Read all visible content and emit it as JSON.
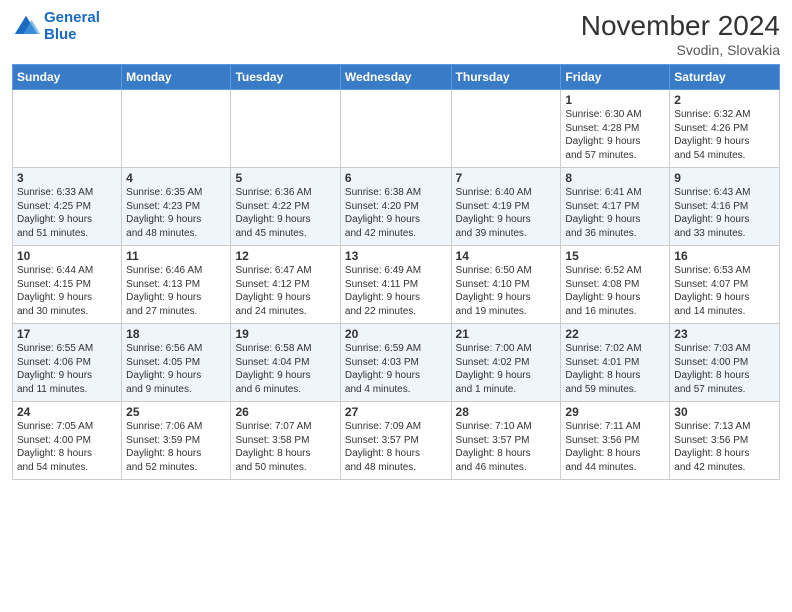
{
  "logo": {
    "line1": "General",
    "line2": "Blue"
  },
  "title": "November 2024",
  "location": "Svodin, Slovakia",
  "days_header": [
    "Sunday",
    "Monday",
    "Tuesday",
    "Wednesday",
    "Thursday",
    "Friday",
    "Saturday"
  ],
  "weeks": [
    [
      {
        "day": "",
        "info": ""
      },
      {
        "day": "",
        "info": ""
      },
      {
        "day": "",
        "info": ""
      },
      {
        "day": "",
        "info": ""
      },
      {
        "day": "",
        "info": ""
      },
      {
        "day": "1",
        "info": "Sunrise: 6:30 AM\nSunset: 4:28 PM\nDaylight: 9 hours\nand 57 minutes."
      },
      {
        "day": "2",
        "info": "Sunrise: 6:32 AM\nSunset: 4:26 PM\nDaylight: 9 hours\nand 54 minutes."
      }
    ],
    [
      {
        "day": "3",
        "info": "Sunrise: 6:33 AM\nSunset: 4:25 PM\nDaylight: 9 hours\nand 51 minutes."
      },
      {
        "day": "4",
        "info": "Sunrise: 6:35 AM\nSunset: 4:23 PM\nDaylight: 9 hours\nand 48 minutes."
      },
      {
        "day": "5",
        "info": "Sunrise: 6:36 AM\nSunset: 4:22 PM\nDaylight: 9 hours\nand 45 minutes."
      },
      {
        "day": "6",
        "info": "Sunrise: 6:38 AM\nSunset: 4:20 PM\nDaylight: 9 hours\nand 42 minutes."
      },
      {
        "day": "7",
        "info": "Sunrise: 6:40 AM\nSunset: 4:19 PM\nDaylight: 9 hours\nand 39 minutes."
      },
      {
        "day": "8",
        "info": "Sunrise: 6:41 AM\nSunset: 4:17 PM\nDaylight: 9 hours\nand 36 minutes."
      },
      {
        "day": "9",
        "info": "Sunrise: 6:43 AM\nSunset: 4:16 PM\nDaylight: 9 hours\nand 33 minutes."
      }
    ],
    [
      {
        "day": "10",
        "info": "Sunrise: 6:44 AM\nSunset: 4:15 PM\nDaylight: 9 hours\nand 30 minutes."
      },
      {
        "day": "11",
        "info": "Sunrise: 6:46 AM\nSunset: 4:13 PM\nDaylight: 9 hours\nand 27 minutes."
      },
      {
        "day": "12",
        "info": "Sunrise: 6:47 AM\nSunset: 4:12 PM\nDaylight: 9 hours\nand 24 minutes."
      },
      {
        "day": "13",
        "info": "Sunrise: 6:49 AM\nSunset: 4:11 PM\nDaylight: 9 hours\nand 22 minutes."
      },
      {
        "day": "14",
        "info": "Sunrise: 6:50 AM\nSunset: 4:10 PM\nDaylight: 9 hours\nand 19 minutes."
      },
      {
        "day": "15",
        "info": "Sunrise: 6:52 AM\nSunset: 4:08 PM\nDaylight: 9 hours\nand 16 minutes."
      },
      {
        "day": "16",
        "info": "Sunrise: 6:53 AM\nSunset: 4:07 PM\nDaylight: 9 hours\nand 14 minutes."
      }
    ],
    [
      {
        "day": "17",
        "info": "Sunrise: 6:55 AM\nSunset: 4:06 PM\nDaylight: 9 hours\nand 11 minutes."
      },
      {
        "day": "18",
        "info": "Sunrise: 6:56 AM\nSunset: 4:05 PM\nDaylight: 9 hours\nand 9 minutes."
      },
      {
        "day": "19",
        "info": "Sunrise: 6:58 AM\nSunset: 4:04 PM\nDaylight: 9 hours\nand 6 minutes."
      },
      {
        "day": "20",
        "info": "Sunrise: 6:59 AM\nSunset: 4:03 PM\nDaylight: 9 hours\nand 4 minutes."
      },
      {
        "day": "21",
        "info": "Sunrise: 7:00 AM\nSunset: 4:02 PM\nDaylight: 9 hours\nand 1 minute."
      },
      {
        "day": "22",
        "info": "Sunrise: 7:02 AM\nSunset: 4:01 PM\nDaylight: 8 hours\nand 59 minutes."
      },
      {
        "day": "23",
        "info": "Sunrise: 7:03 AM\nSunset: 4:00 PM\nDaylight: 8 hours\nand 57 minutes."
      }
    ],
    [
      {
        "day": "24",
        "info": "Sunrise: 7:05 AM\nSunset: 4:00 PM\nDaylight: 8 hours\nand 54 minutes."
      },
      {
        "day": "25",
        "info": "Sunrise: 7:06 AM\nSunset: 3:59 PM\nDaylight: 8 hours\nand 52 minutes."
      },
      {
        "day": "26",
        "info": "Sunrise: 7:07 AM\nSunset: 3:58 PM\nDaylight: 8 hours\nand 50 minutes."
      },
      {
        "day": "27",
        "info": "Sunrise: 7:09 AM\nSunset: 3:57 PM\nDaylight: 8 hours\nand 48 minutes."
      },
      {
        "day": "28",
        "info": "Sunrise: 7:10 AM\nSunset: 3:57 PM\nDaylight: 8 hours\nand 46 minutes."
      },
      {
        "day": "29",
        "info": "Sunrise: 7:11 AM\nSunset: 3:56 PM\nDaylight: 8 hours\nand 44 minutes."
      },
      {
        "day": "30",
        "info": "Sunrise: 7:13 AM\nSunset: 3:56 PM\nDaylight: 8 hours\nand 42 minutes."
      }
    ]
  ]
}
